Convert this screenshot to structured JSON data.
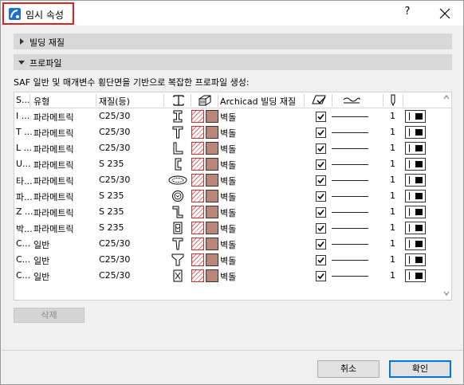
{
  "window": {
    "title": "임시 속성",
    "help_label": "?",
    "accent_color": "#e02020"
  },
  "sections": {
    "building_material": "빌딩 재질",
    "profile": "프로파일"
  },
  "description": "SAF 일반 및 매개변수 횡단면을 기반으로 복잡한 프로파일 생성:",
  "table": {
    "headers": {
      "col_s": "S...",
      "type": "유형",
      "material": "재질(등)",
      "archicad_material": "Archicad 빌딩 재질"
    },
    "rows": [
      {
        "s": "I ...",
        "type": "파라메트릭",
        "material": "C25/30",
        "shape": "i-beam",
        "ac_material": "벽돌",
        "pen": "1"
      },
      {
        "s": "T ...",
        "type": "파라메트릭",
        "material": "C25/30",
        "shape": "t-beam",
        "ac_material": "벽돌",
        "pen": "1"
      },
      {
        "s": "L ...",
        "type": "파라메트릭",
        "material": "C25/30",
        "shape": "l-angle",
        "ac_material": "벽돌",
        "pen": "1"
      },
      {
        "s": "U...",
        "type": "파라메트릭",
        "material": "S 235",
        "shape": "u-channel",
        "ac_material": "벽돌",
        "pen": "1"
      },
      {
        "s": "타...",
        "type": "파라메트릭",
        "material": "C25/30",
        "shape": "ellipse",
        "ac_material": "벽돌",
        "pen": "1"
      },
      {
        "s": "파...",
        "type": "파라메트릭",
        "material": "S 235",
        "shape": "pipe",
        "ac_material": "벽돌",
        "pen": "1"
      },
      {
        "s": "Z ...",
        "type": "파라메트릭",
        "material": "S 235",
        "shape": "z-section",
        "ac_material": "벽돌",
        "pen": "1"
      },
      {
        "s": "박...",
        "type": "파라메트릭",
        "material": "S 235",
        "shape": "box",
        "ac_material": "벽돌",
        "pen": "1"
      },
      {
        "s": "C...",
        "type": "일반",
        "material": "C25/30",
        "shape": "t-general",
        "ac_material": "벽돌",
        "pen": "1"
      },
      {
        "s": "C...",
        "type": "일반",
        "material": "C25/30",
        "shape": "y-general",
        "ac_material": "벽돌",
        "pen": "1"
      },
      {
        "s": "C...",
        "type": "일반",
        "material": "C25/30",
        "shape": "cross-general",
        "ac_material": "벽돌",
        "pen": "1"
      }
    ]
  },
  "buttons": {
    "delete": "삭제",
    "cancel": "취소",
    "ok": "확인"
  }
}
